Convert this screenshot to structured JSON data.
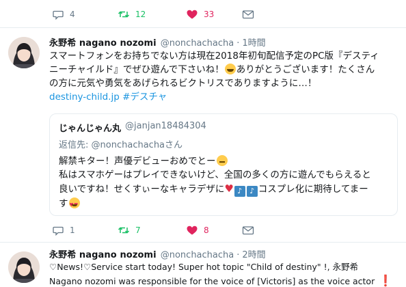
{
  "top_actions": {
    "reply_count": "4",
    "retweet_count": "12",
    "like_count": "33"
  },
  "tweet1": {
    "name": "永野希 nagano nozomi",
    "handle": "@nonchachacha",
    "separator": "·",
    "time": "1時間",
    "lines": [
      "スマートフォンをお持ちでない方は現在2018年初旬配信予定のPC版『デスティ",
      "ニーチャイルド』でぜひ遊んで下さいね！",
      "ありがとうございます！たくさん",
      "の方に元気や勇気をあげられるビクトリスでありますように…！"
    ],
    "link": "destiny-child.jp",
    "hashtag": "#デスチャ",
    "quote": {
      "name": "じゃんじゃん丸",
      "handle": "@janjan18484304",
      "reply_prefix": "返信先:",
      "reply_handle": "@nonchachachaさん",
      "lines": [
        "解禁キター！声優デビューおめでとー",
        "私はスマホゲーはプレイできないけど、全国の多くの方に遊んでもらえると",
        "良いですね！せくすぃーなキャラデザに",
        "コスプレ化に期待してまー",
        "す"
      ]
    },
    "actions": {
      "reply_count": "1",
      "retweet_count": "7",
      "like_count": "8"
    }
  },
  "tweet2": {
    "name": "永野希 nagano nozomi",
    "handle": "@nonchachacha",
    "separator": "·",
    "time": "2時間",
    "lines": [
      "♡News!♡Service start today! Super hot topic \"Child of destiny\" !, 永野希",
      "Nagano nozomi was responsible for the voice of [Victoris] as the voice actor"
    ]
  },
  "colors": {
    "retweet": "#17bf63",
    "like": "#e0245e",
    "link": "#1b95e0",
    "muted": "#657786"
  },
  "icons": [
    "reply-icon",
    "retweet-icon",
    "heart-icon",
    "envelope-icon"
  ]
}
